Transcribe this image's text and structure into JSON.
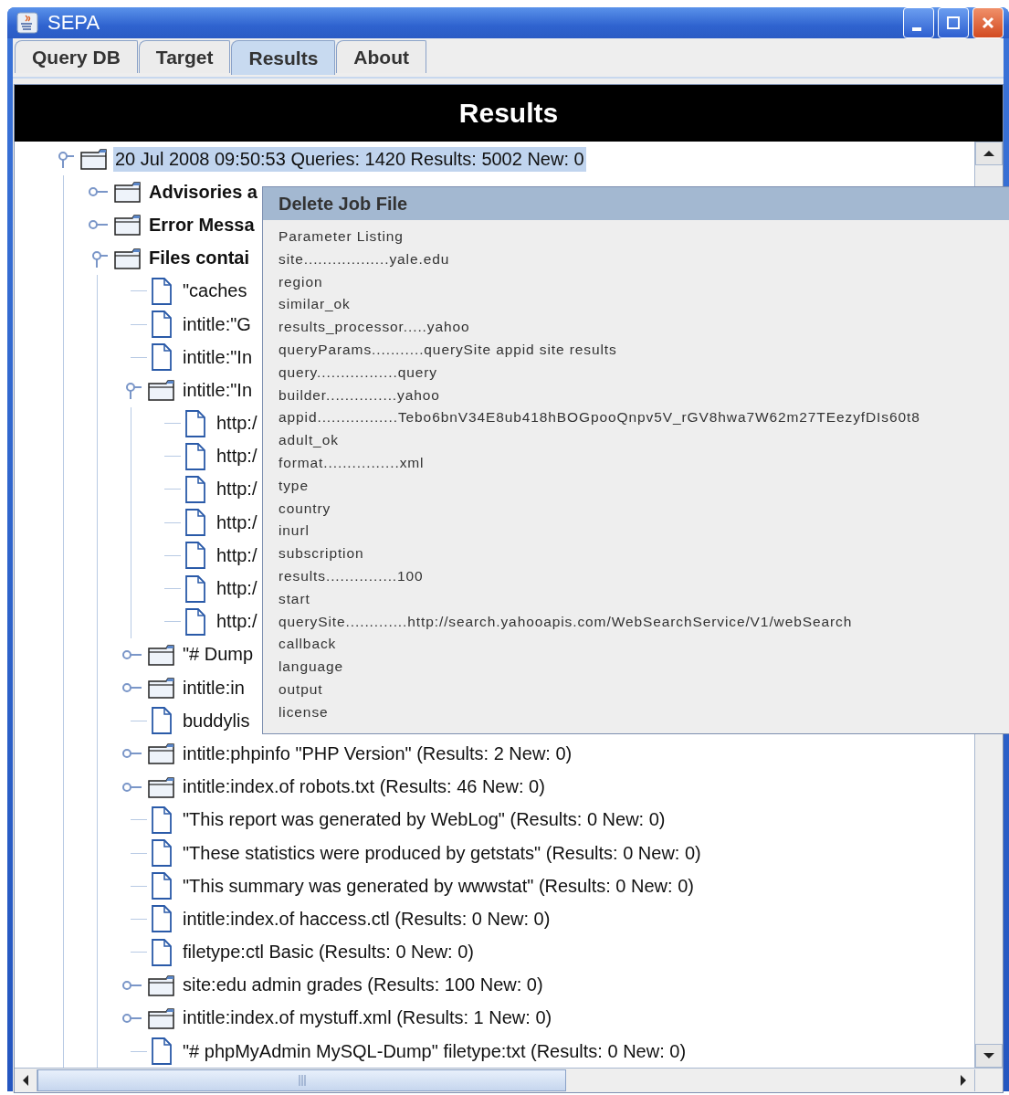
{
  "window": {
    "title": "SEPA"
  },
  "tabs": [
    {
      "label": "Query DB",
      "selected": false
    },
    {
      "label": "Target",
      "selected": false
    },
    {
      "label": "Results",
      "selected": true
    },
    {
      "label": "About",
      "selected": false
    }
  ],
  "header": "Results",
  "tree": [
    {
      "text": "20 Jul 2008 09:50:53 Queries: 1420 Results: 5002 New: 0",
      "kind": "folder",
      "expanded": true,
      "selected": true,
      "children": [
        {
          "text": "Advisories a",
          "kind": "folder",
          "expanded": false,
          "selected": false
        },
        {
          "text": "Error Messa",
          "kind": "folder",
          "expanded": false,
          "selected": false
        },
        {
          "text": "Files contai",
          "kind": "folder",
          "expanded": true,
          "selected": false,
          "children": [
            {
              "text": "\"caches",
              "kind": "file",
              "selected": false
            },
            {
              "text": "intitle:\"G",
              "kind": "file",
              "selected": false
            },
            {
              "text": "intitle:\"In",
              "kind": "file",
              "selected": false
            },
            {
              "text": "intitle:\"In",
              "kind": "folder",
              "expanded": true,
              "selected": false,
              "children": [
                {
                  "text": "http:/",
                  "kind": "file",
                  "selected": false
                },
                {
                  "text": "http:/",
                  "kind": "file",
                  "selected": false
                },
                {
                  "text": "http:/",
                  "kind": "file",
                  "selected": false
                },
                {
                  "text": "http:/",
                  "kind": "file",
                  "selected": false
                },
                {
                  "text": "http:/",
                  "kind": "file",
                  "selected": false
                },
                {
                  "text": "http:/",
                  "kind": "file",
                  "selected": false
                },
                {
                  "text": "http:/",
                  "kind": "file",
                  "selected": false
                }
              ]
            },
            {
              "text": "\"# Dump",
              "kind": "folder",
              "expanded": false,
              "selected": false
            },
            {
              "text": "intitle:in",
              "kind": "folder",
              "expanded": false,
              "selected": false
            },
            {
              "text": "buddylis",
              "kind": "file",
              "selected": false
            },
            {
              "text": "intitle:phpinfo \"PHP Version\" (Results: 2 New: 0)",
              "kind": "folder",
              "expanded": false,
              "selected": false
            },
            {
              "text": "intitle:index.of robots.txt (Results: 46 New: 0)",
              "kind": "folder",
              "expanded": false,
              "selected": false
            },
            {
              "text": "\"This report was generated by WebLog\" (Results: 0 New: 0)",
              "kind": "file",
              "selected": false
            },
            {
              "text": "\"These statistics were produced by getstats\" (Results: 0 New: 0)",
              "kind": "file",
              "selected": false
            },
            {
              "text": "\"This summary was generated by wwwstat\" (Results: 0 New: 0)",
              "kind": "file",
              "selected": false
            },
            {
              "text": "intitle:index.of haccess.ctl (Results: 0 New: 0)",
              "kind": "file",
              "selected": false
            },
            {
              "text": "filetype:ctl Basic (Results: 0 New: 0)",
              "kind": "file",
              "selected": false
            },
            {
              "text": "site:edu admin grades (Results: 100 New: 0)",
              "kind": "folder",
              "expanded": false,
              "selected": false
            },
            {
              "text": "intitle:index.of mystuff.xml (Results: 1 New: 0)",
              "kind": "folder",
              "expanded": false,
              "selected": false
            },
            {
              "text": "\"# phpMyAdmin MySQL-Dump\" filetype:txt (Results: 0 New: 0)",
              "kind": "file",
              "selected": false
            }
          ]
        }
      ]
    }
  ],
  "popup": {
    "title": "Delete Job File",
    "heading": "Parameter Listing",
    "lines": [
      "site..................yale.edu",
      "region",
      "similar_ok",
      "results_processor.....yahoo",
      "queryParams...........querySite appid site results",
      "query.................query",
      "builder...............yahoo",
      "appid.................Tebo6bnV34E8ub418hBOGpooQnpv5V_rGV8hwa7W62m27TEezyfDIs60t8",
      "adult_ok",
      "format................xml",
      "type",
      "country",
      "inurl",
      "subscription",
      "results...............100",
      "start",
      "querySite.............http://search.yahooapis.com/WebSearchService/V1/webSearch",
      "callback",
      "language",
      "output",
      "license"
    ]
  }
}
